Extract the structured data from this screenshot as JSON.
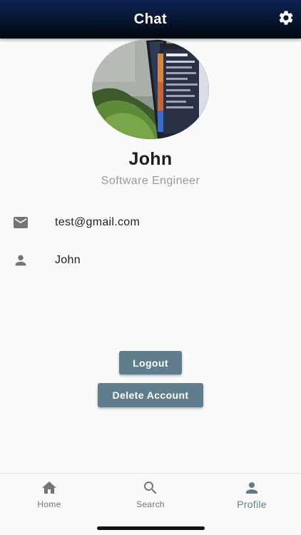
{
  "appbar": {
    "title": "Chat",
    "settings_icon": "gear-icon",
    "gradient_top": "#0b2350",
    "gradient_bottom": "#03070f"
  },
  "profile": {
    "avatar_description_icon": "avatar",
    "name": "John",
    "title": "Software Engineer"
  },
  "info": {
    "email": {
      "icon": "mail-icon",
      "value": "test@gmail.com"
    },
    "username": {
      "icon": "person-icon",
      "value": "John"
    }
  },
  "actions": {
    "logout_label": "Logout",
    "delete_label": "Delete Account",
    "button_color": "#5f7d8c"
  },
  "bottom_nav": {
    "items": [
      {
        "label": "Home",
        "icon": "home-icon",
        "active": false
      },
      {
        "label": "Search",
        "icon": "search-icon",
        "active": false
      },
      {
        "label": "Profile",
        "icon": "person-icon",
        "active": true
      }
    ],
    "active_color": "#5f7d8c",
    "inactive_color": "#757575"
  }
}
